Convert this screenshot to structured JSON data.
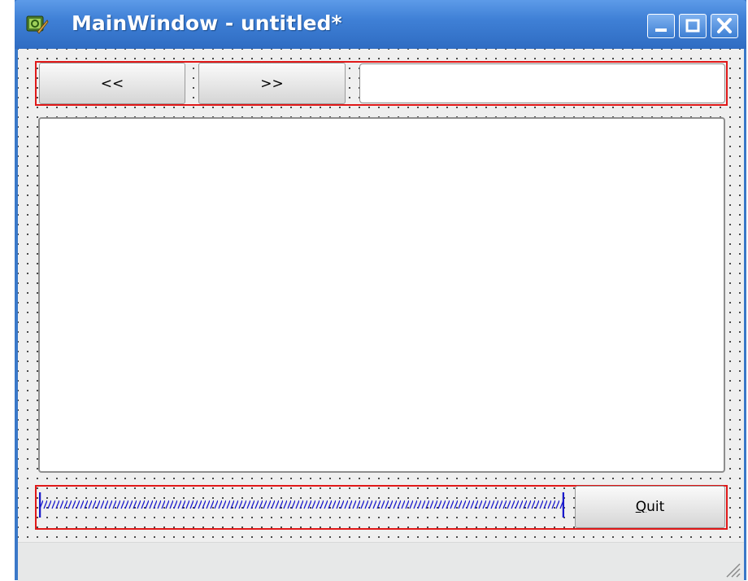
{
  "window": {
    "title": "MainWindow - untitled*",
    "controls": [
      "minimize-icon",
      "maximize-icon",
      "close-icon"
    ]
  },
  "toolbar_row": {
    "back_label": "<<",
    "forward_label": ">>",
    "address_value": ""
  },
  "content": {
    "text_value": ""
  },
  "bottom_row": {
    "quit_mnemonic": "Q",
    "quit_rest": "uit"
  },
  "colors": {
    "titlebar": "#3f80d6",
    "layout_outline": "#e01818",
    "spacer": "#1a1acc",
    "client_bg": "#efefef"
  }
}
